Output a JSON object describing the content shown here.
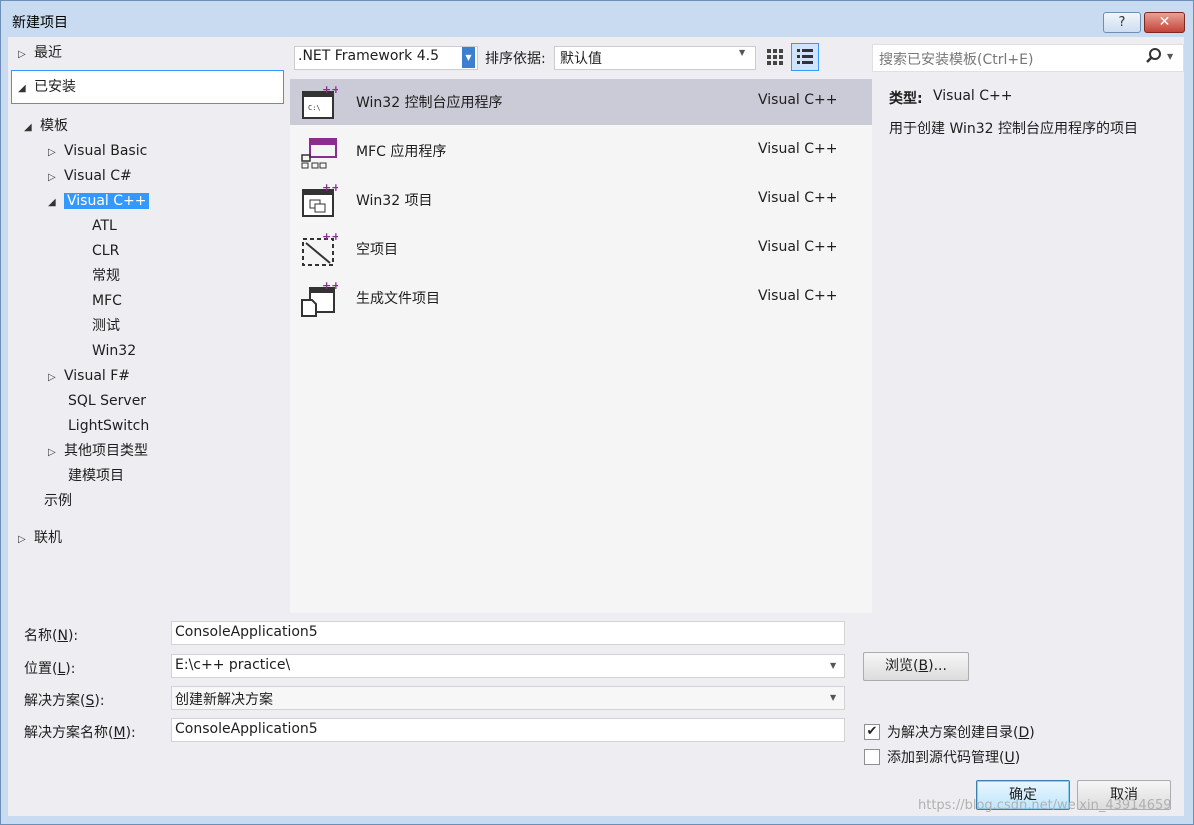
{
  "window": {
    "title": "新建项目",
    "help_label": "?",
    "close_label": "✕"
  },
  "tree": {
    "recent": "最近",
    "installed": "已安装",
    "templates": "模板",
    "items": [
      {
        "label": "Visual Basic",
        "arrow": "▷"
      },
      {
        "label": "Visual C#",
        "arrow": "▷"
      },
      {
        "label": "Visual C++",
        "arrow": "◢"
      },
      {
        "label": "ATL",
        "arrow": ""
      },
      {
        "label": "CLR",
        "arrow": ""
      },
      {
        "label": "常规",
        "arrow": ""
      },
      {
        "label": "MFC",
        "arrow": ""
      },
      {
        "label": "测试",
        "arrow": ""
      },
      {
        "label": "Win32",
        "arrow": ""
      },
      {
        "label": "Visual F#",
        "arrow": "▷"
      },
      {
        "label": "SQL Server",
        "arrow": ""
      },
      {
        "label": "LightSwitch",
        "arrow": ""
      },
      {
        "label": "其他项目类型",
        "arrow": "▷"
      },
      {
        "label": "建模项目",
        "arrow": ""
      }
    ],
    "samples": "示例",
    "online": "联机"
  },
  "toolbar": {
    "framework": ".NET Framework 4.5",
    "sort_label": "排序依据:",
    "sort_value": "默认值",
    "search_placeholder": "搜索已安装模板(Ctrl+E)"
  },
  "templates": [
    {
      "name": "Win32 控制台应用程序",
      "lang": "Visual C++",
      "selected": true
    },
    {
      "name": "MFC 应用程序",
      "lang": "Visual C++"
    },
    {
      "name": "Win32 项目",
      "lang": "Visual C++"
    },
    {
      "name": "空项目",
      "lang": "Visual C++"
    },
    {
      "name": "生成文件项目",
      "lang": "Visual C++"
    }
  ],
  "description": {
    "type_label": "类型:",
    "type_value": "Visual C++",
    "text": "用于创建 Win32 控制台应用程序的项目"
  },
  "form": {
    "name_label": "名称",
    "name_key": "N",
    "name_value": "ConsoleApplication5",
    "location_label": "位置",
    "location_key": "L",
    "location_value": "E:\\c++ practice\\",
    "solution_label": "解决方案",
    "solution_key": "S",
    "solution_value": "创建新解决方案",
    "solution_name_label": "解决方案名称",
    "solution_name_key": "M",
    "solution_name_value": "ConsoleApplication5",
    "browse_label": "浏览",
    "browse_key": "B",
    "create_dir_label": "为解决方案创建目录",
    "create_dir_key": "D",
    "create_dir_checked": true,
    "source_control_label": "添加到源代码管理",
    "source_control_key": "U",
    "source_control_checked": false
  },
  "buttons": {
    "ok": "确定",
    "cancel": "取消"
  },
  "watermark": "https://blog.csdn.net/weixin_43914659"
}
